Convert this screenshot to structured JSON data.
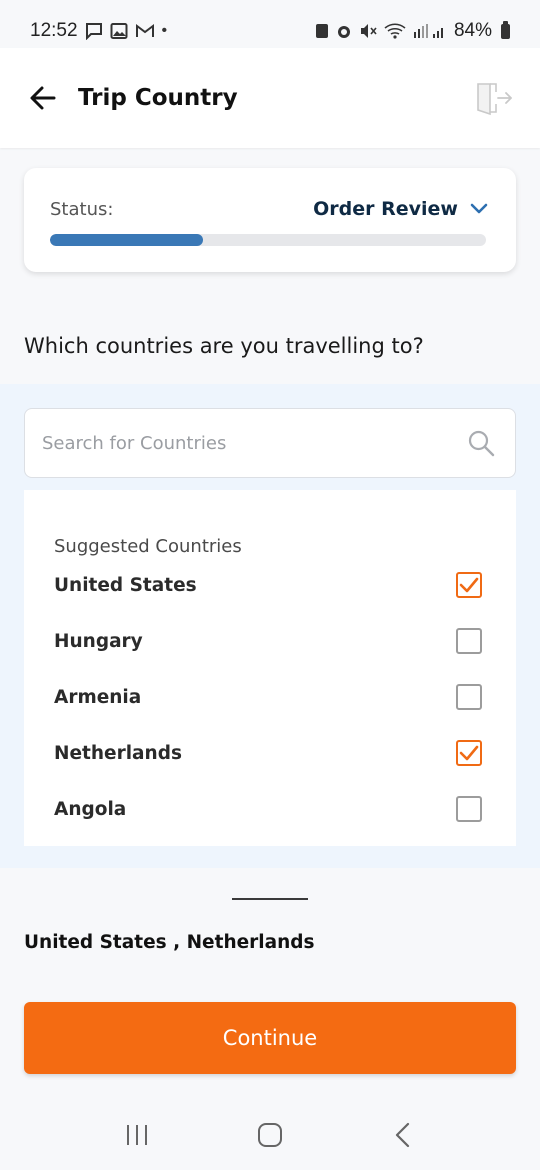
{
  "status_bar": {
    "time": "12:52",
    "battery": "84%",
    "left_icons": [
      "chat-icon",
      "image-icon",
      "gmail-icon",
      "dot-icon"
    ],
    "right_icons": [
      "sync-icon",
      "alarm-icon",
      "mute-icon",
      "wifi-icon",
      "signal-icon",
      "battery-icon"
    ]
  },
  "app_bar": {
    "title": "Trip Country",
    "back_icon": "arrow-left-icon",
    "exit_icon": "exit-door-icon"
  },
  "status_card": {
    "label": "Status:",
    "value": "Order Review",
    "progress_fraction": 0.35,
    "accent_color": "#3a78b6"
  },
  "question": "Which countries are you travelling to?",
  "search": {
    "placeholder": "Search for Countries",
    "value": ""
  },
  "suggested": {
    "title": "Suggested Countries",
    "countries": [
      {
        "name": "United States",
        "checked": true
      },
      {
        "name": "Hungary",
        "checked": false
      },
      {
        "name": "Armenia",
        "checked": false
      },
      {
        "name": "Netherlands",
        "checked": true
      },
      {
        "name": "Angola",
        "checked": false
      }
    ]
  },
  "selection_summary": "United States , Netherlands",
  "continue_label": "Continue",
  "colors": {
    "primary": "#f46b12",
    "check": "#f06a14",
    "section_bg": "#eef5fd"
  },
  "nav": [
    "recents-icon",
    "home-icon",
    "back-icon"
  ]
}
